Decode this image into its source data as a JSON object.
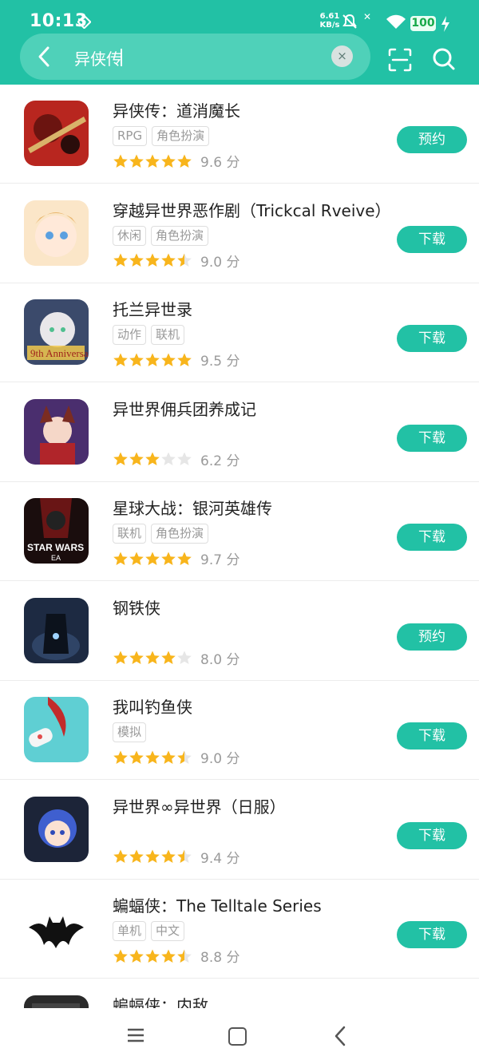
{
  "status_bar": {
    "time": "10:13",
    "net_speed_value": "6.61",
    "net_speed_unit": "KB/s",
    "battery": "100"
  },
  "search": {
    "value": "异侠传",
    "clear_symbol": "×"
  },
  "colors": {
    "accent": "#22c1a5",
    "star_filled": "#f8b51c",
    "star_empty": "#e6e6e6"
  },
  "apps": [
    {
      "name": "异侠传：道消魔长",
      "tags": [
        "RPG",
        "角色扮演"
      ],
      "rating": 5,
      "score": "9.6 分",
      "action": "预约",
      "icon": "game-icon-warrior"
    },
    {
      "name": "穿越异世界恶作剧（Trickcal Rveive）",
      "tags": [
        "休闲",
        "角色扮演"
      ],
      "rating": 4.5,
      "score": "9.0 分",
      "action": "下载",
      "icon": "game-icon-anime-girl"
    },
    {
      "name": "托兰异世录",
      "tags": [
        "动作",
        "联机"
      ],
      "rating": 5,
      "score": "9.5 分",
      "action": "下载",
      "icon": "game-icon-9th-anniversary"
    },
    {
      "name": "异世界佣兵团养成记",
      "tags": [],
      "rating": 3,
      "score": "6.2 分",
      "action": "下载",
      "icon": "game-icon-fox-girl"
    },
    {
      "name": "星球大战：银河英雄传",
      "tags": [
        "联机",
        "角色扮演"
      ],
      "rating": 5,
      "score": "9.7 分",
      "action": "下载",
      "icon": "game-icon-star-wars"
    },
    {
      "name": "钢铁侠",
      "tags": [],
      "rating": 4,
      "score": "8.0 分",
      "action": "预约",
      "icon": "game-icon-iron-man"
    },
    {
      "name": "我叫钓鱼侠",
      "tags": [
        "模拟"
      ],
      "rating": 4.5,
      "score": "9.0 分",
      "action": "下载",
      "icon": "game-icon-fishing"
    },
    {
      "name": "异世界∞异世界（日服）",
      "tags": [],
      "rating": 4.5,
      "score": "9.4 分",
      "action": "下载",
      "icon": "game-icon-blue-hair-girl"
    },
    {
      "name": "蝙蝠侠：The Telltale Series",
      "tags": [
        "单机",
        "中文"
      ],
      "rating": 4.5,
      "score": "8.8 分",
      "action": "下载",
      "icon": "game-icon-batman"
    },
    {
      "name": "蝙蝠侠：内敌",
      "tags": [],
      "rating": 0,
      "score": "",
      "action": "",
      "icon": "game-icon-batman-dark"
    }
  ]
}
